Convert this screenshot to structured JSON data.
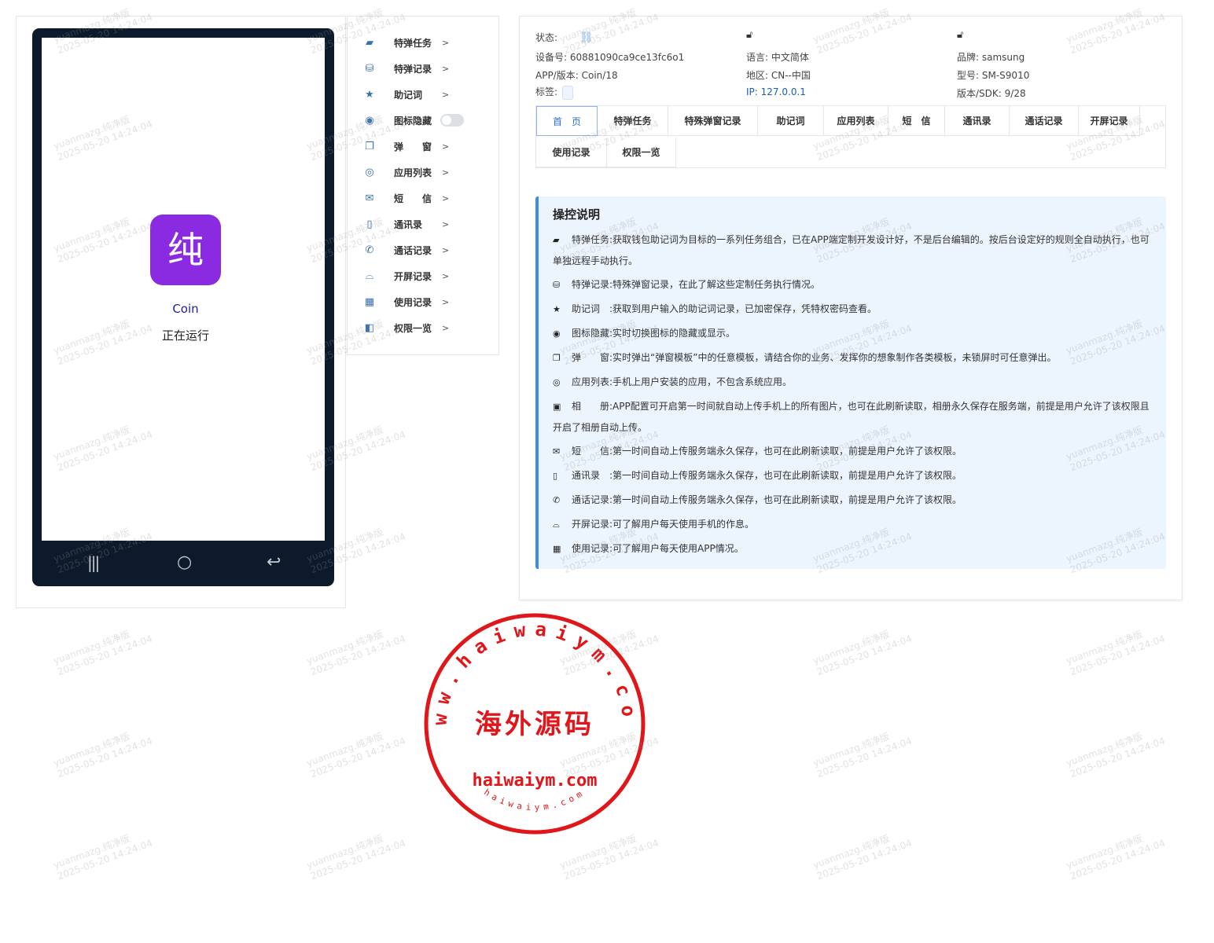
{
  "phone": {
    "app_icon_char": "纯",
    "app_name": "Coin",
    "app_status": "正在运行",
    "nav_recent": "|||",
    "nav_home": "○",
    "nav_back": "↩"
  },
  "menu": {
    "items": [
      {
        "label": "特弹任务",
        "arrow": ">",
        "icon": "wallet-icon",
        "glyph": "▰"
      },
      {
        "label": "特弹记录",
        "arrow": ">",
        "icon": "database-icon",
        "glyph": "⛁"
      },
      {
        "label": "助记词",
        "arrow": ">",
        "icon": "star-icon",
        "glyph": "★"
      },
      {
        "label": "图标隐藏",
        "arrow": "",
        "icon": "eye-icon",
        "glyph": "◉"
      },
      {
        "label": "弹　　窗",
        "arrow": ">",
        "icon": "copy-icon",
        "glyph": "❐"
      },
      {
        "label": "应用列表",
        "arrow": ">",
        "icon": "chrome-icon",
        "glyph": "◎"
      },
      {
        "label": "短　　信",
        "arrow": ">",
        "icon": "mail-icon",
        "glyph": "✉"
      },
      {
        "label": "通讯录",
        "arrow": ">",
        "icon": "contacts-icon",
        "glyph": "▯"
      },
      {
        "label": "通话记录",
        "arrow": ">",
        "icon": "phone-icon",
        "glyph": "✆"
      },
      {
        "label": "开屏记录",
        "arrow": ">",
        "icon": "sunrise-icon",
        "glyph": "⌓"
      },
      {
        "label": "使用记录",
        "arrow": ">",
        "icon": "grid-icon",
        "glyph": "▦"
      },
      {
        "label": "权限一览",
        "arrow": ">",
        "icon": "switch-icon",
        "glyph": "◧"
      }
    ]
  },
  "device": {
    "status_label": "状态:",
    "device_id_label": "设备号:",
    "device_id": "60881090ca9ce13fc6o1",
    "app_version_label": "APP/版本:",
    "app_version": "Coin/18",
    "tag_label": "标签:",
    "language_label": "语言:",
    "language": "中文简体",
    "region_label": "地区:",
    "region": "CN--中国",
    "ip_label": "IP:",
    "ip": "127.0.0.1",
    "brand_label": "品牌:",
    "brand": "samsung",
    "model_label": "型号:",
    "model": "SM-S9010",
    "sdk_label": "版本/SDK:",
    "sdk": "9/28"
  },
  "tabs": [
    "首　页",
    "特弹任务",
    "特殊弹窗记录",
    "助记词",
    "应用列表",
    "短　信",
    "通讯录",
    "通话记录",
    "开屏记录",
    "使用记录",
    "权限一览"
  ],
  "instructions": {
    "title": "操控说明",
    "lines": [
      {
        "icon": "wallet-icon",
        "glyph": "▰",
        "label": "特弹任务:",
        "text": "获取钱包助记词为目标的一系列任务组合，已在APP端定制开发设计好，不是后台编辑的。按后台设定好的规则全自动执行，也可单独远程手动执行。"
      },
      {
        "icon": "database-icon",
        "glyph": "⛁",
        "label": "特弹记录:",
        "text": "特殊弹窗记录，在此了解这些定制任务执行情况。"
      },
      {
        "icon": "star-icon",
        "glyph": "★",
        "label": "助记词　:",
        "text": "获取到用户输入的助记词记录，已加密保存，凭特权密码查看。"
      },
      {
        "icon": "eye-icon",
        "glyph": "◉",
        "label": "图标隐藏:",
        "text": "实时切换图标的隐藏或显示。"
      },
      {
        "icon": "copy-icon",
        "glyph": "❐",
        "label": "弹　　窗:",
        "text": "实时弹出“弹窗模板”中的任意模板，请结合你的业务、发挥你的想象制作各类模板，未锁屏时可任意弹出。"
      },
      {
        "icon": "chrome-icon",
        "glyph": "◎",
        "label": "应用列表:",
        "text": "手机上用户安装的应用，不包含系统应用。"
      },
      {
        "icon": "image-icon",
        "glyph": "▣",
        "label": "相　　册:",
        "text": "APP配置可开启第一时间就自动上传手机上的所有图片，也可在此刷新读取，相册永久保存在服务端，前提是用户允许了该权限且开启了相册自动上传。"
      },
      {
        "icon": "mail-icon",
        "glyph": "✉",
        "label": "短　　信:",
        "text": "第一时间自动上传服务端永久保存，也可在此刷新读取，前提是用户允许了该权限。"
      },
      {
        "icon": "contacts-icon",
        "glyph": "▯",
        "label": "通讯录　:",
        "text": "第一时间自动上传服务端永久保存，也可在此刷新读取，前提是用户允许了该权限。"
      },
      {
        "icon": "phone-icon",
        "glyph": "✆",
        "label": "通话记录:",
        "text": "第一时间自动上传服务端永久保存，也可在此刷新读取，前提是用户允许了该权限。"
      },
      {
        "icon": "sunrise-icon",
        "glyph": "⌓",
        "label": "开屏记录:",
        "text": "可了解用户每天使用手机的作息。"
      },
      {
        "icon": "grid-icon",
        "glyph": "▦",
        "label": "使用记录:",
        "text": "可了解用户每天使用APP情况。"
      }
    ]
  },
  "watermark": {
    "line1": "yuanmazg.纯净版",
    "line2": "2025-05-20 14:24:04"
  },
  "stamp": {
    "center_text": "海外源码",
    "bottom_text": "haiwaiym.com",
    "ring_text": "www.haiwaiym.com",
    "inner_ring_text": "haiwaiym.com",
    "color": "#e0161b"
  },
  "colors": {
    "accent": "#3d8cf0",
    "app_icon": "#8a2be2",
    "phone_frame": "#0c1a2b"
  }
}
